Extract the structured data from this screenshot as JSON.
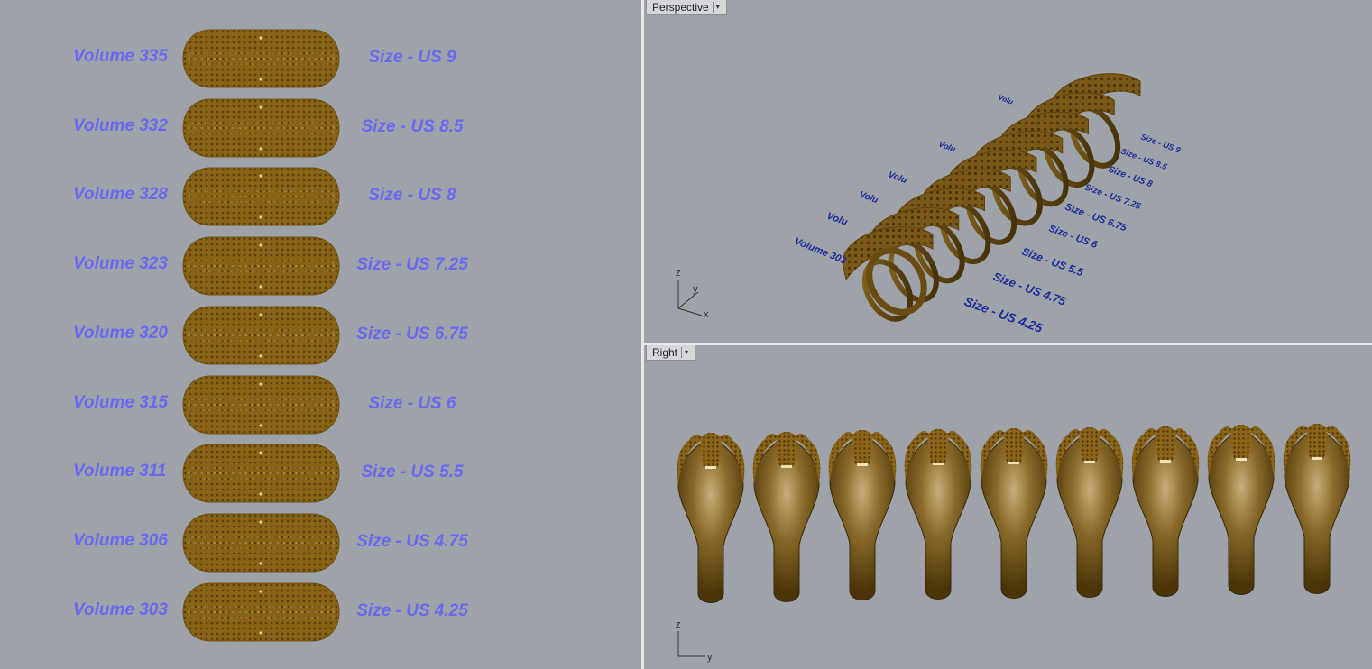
{
  "viewports": {
    "perspective": {
      "title": "Perspective",
      "dropdown_icon": "caret-down-icon"
    },
    "right": {
      "title": "Right",
      "dropdown_icon": "caret-down-icon"
    }
  },
  "rings": [
    {
      "volume": "Volume 335",
      "size": "Size - US 9"
    },
    {
      "volume": "Volume 332",
      "size": "Size - US 8.5"
    },
    {
      "volume": "Volume 328",
      "size": "Size - US 8"
    },
    {
      "volume": "Volume 323",
      "size": "Size - US 7.25"
    },
    {
      "volume": "Volume 320",
      "size": "Size - US 6.75"
    },
    {
      "volume": "Volume 315",
      "size": "Size - US 6"
    },
    {
      "volume": "Volume 311",
      "size": "Size - US 5.5"
    },
    {
      "volume": "Volume 306",
      "size": "Size - US 4.75"
    },
    {
      "volume": "Volume 303",
      "size": "Size - US 4.25"
    }
  ],
  "perspective_labels": {
    "sizes": [
      "Size - US 9",
      "Size - US 8.5",
      "Size - US 8",
      "Size - US 7.25",
      "Size - US 6.75",
      "Size - US 6",
      "Size - US 5.5",
      "Size - US 4.75",
      "Size - US 4.25"
    ],
    "volume_first": "Volume 303",
    "volume_partial": [
      "Volu",
      "Volu",
      "Volu",
      "Volu",
      "Volu"
    ]
  },
  "axes": {
    "perspective": {
      "x": "x",
      "y": "y",
      "z": "z"
    },
    "right": {
      "y": "y",
      "z": "z"
    }
  },
  "colors": {
    "viewport_bg": "#9ea3aa",
    "label_top": "#6a67f0",
    "label_persp": "#1a2a9a",
    "gold": "#7a5a14"
  }
}
